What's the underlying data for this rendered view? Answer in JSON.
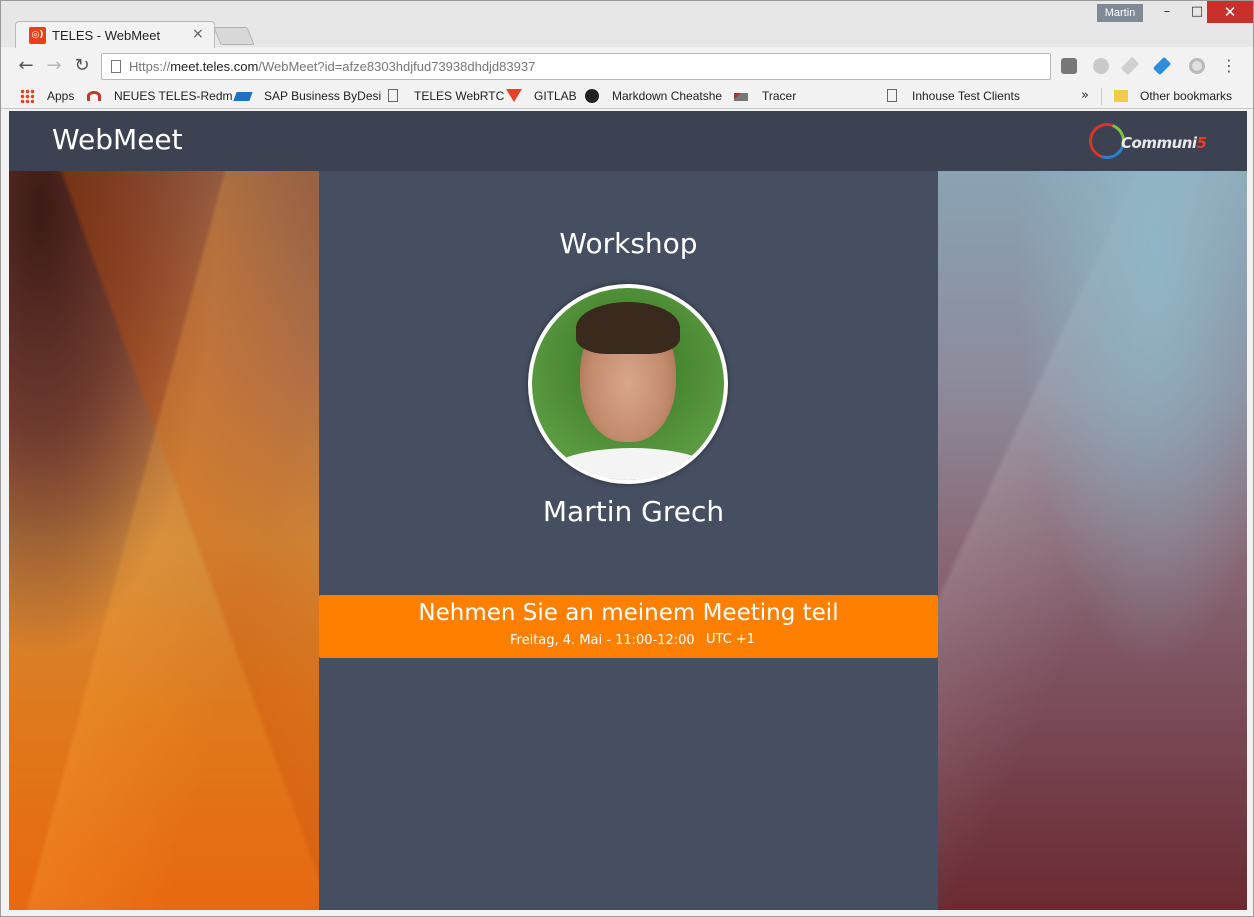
{
  "browser": {
    "tab_title": "TELES - WebMeet",
    "tab_close": "×",
    "favicon_glyph": "◎)",
    "user_name": "Martin",
    "window_buttons": {
      "minimize": "–",
      "maximize": "□",
      "close": "✕"
    },
    "nav": {
      "back": "←",
      "forward": "→",
      "reload": "↻"
    },
    "url_scheme": "Https://",
    "url_host": "meet.teles.com",
    "url_path": "/WebMeet?id=afze8303hdjfud73938dhdjd83937",
    "menu_glyph": "⋮"
  },
  "bookmarks": {
    "items": [
      "Apps",
      "NEUES TELES-Redm",
      "SAP Business ByDesi",
      "TELES WebRTC",
      "GITLAB",
      "Markdown Cheatshe",
      "Tracer",
      "Inhouse Test Clients"
    ],
    "more": "»",
    "other": "Other bookmarks"
  },
  "app": {
    "brand": "WebMeet",
    "logo_text_a": "Communi",
    "logo_text_b": "5",
    "meeting_title": "Workshop",
    "host_name": "Martin Grech",
    "join_label": "Nehmen Sie an meinem Meeting teil",
    "join_date": "Freitag, 4. Mai - 11:00-12:00",
    "join_tz": "UTC +1"
  },
  "colors": {
    "header_bg": "#3c4251",
    "panel_bg": "#464f61",
    "accent": "#ff8000"
  }
}
